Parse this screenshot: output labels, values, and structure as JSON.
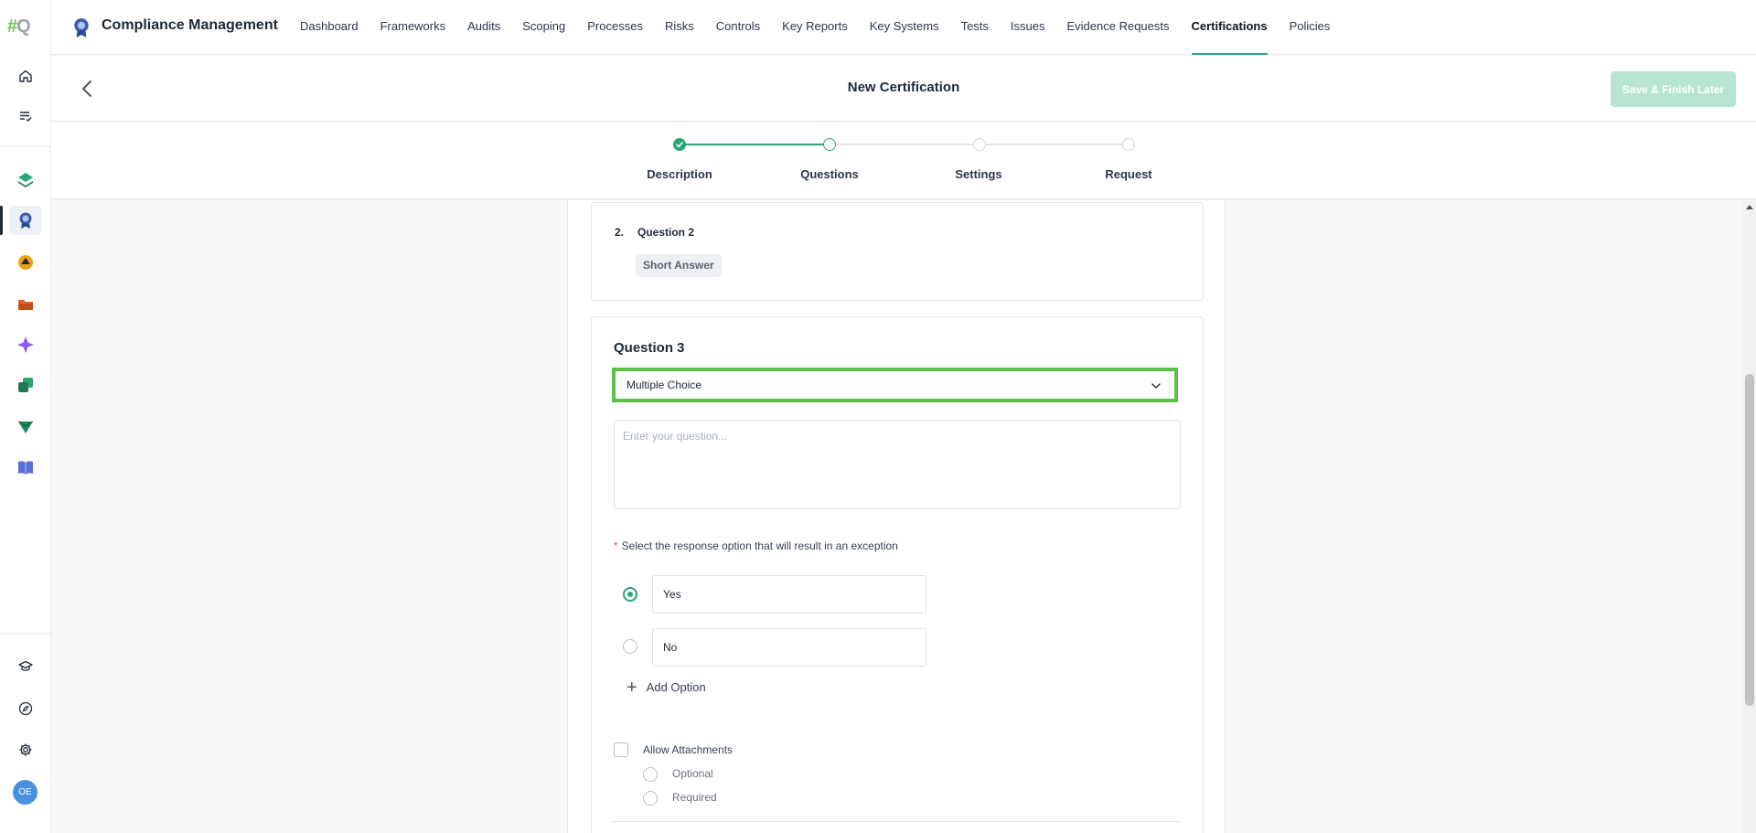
{
  "rail": {
    "logo_hash": "#",
    "logo_q": "Q",
    "avatar_initials": "OE"
  },
  "app": {
    "title": "Compliance Management"
  },
  "nav": {
    "items": [
      {
        "label": "Dashboard"
      },
      {
        "label": "Frameworks"
      },
      {
        "label": "Audits"
      },
      {
        "label": "Scoping"
      },
      {
        "label": "Processes"
      },
      {
        "label": "Risks"
      },
      {
        "label": "Controls"
      },
      {
        "label": "Key Reports"
      },
      {
        "label": "Key Systems"
      },
      {
        "label": "Tests"
      },
      {
        "label": "Issues"
      },
      {
        "label": "Evidence Requests"
      },
      {
        "label": "Certifications",
        "active": true
      },
      {
        "label": "Policies"
      }
    ]
  },
  "header": {
    "title": "New Certification",
    "save_label": "Save & Finish Later"
  },
  "stepper": {
    "steps": [
      {
        "label": "Description",
        "state": "done"
      },
      {
        "label": "Questions",
        "state": "current"
      },
      {
        "label": "Settings",
        "state": "pending"
      },
      {
        "label": "Request",
        "state": "pending"
      }
    ]
  },
  "question2": {
    "number": "2.",
    "text": "Question 2",
    "type": "Short Answer"
  },
  "question3": {
    "title": "Question 3",
    "type": "Multiple Choice",
    "question_placeholder": "Enter your question...",
    "exception_label": "Select the response option that will result in an exception",
    "required_marker": "*",
    "options": [
      {
        "value": "Yes",
        "selected": true
      },
      {
        "value": "No",
        "selected": false
      }
    ],
    "add_option_label": "Add Option",
    "allow_attachments_label": "Allow Attachments",
    "attachment_optional_label": "Optional",
    "attachment_required_label": "Required"
  },
  "colors": {
    "accent": "#2aa675",
    "highlight_border": "#5fbf49",
    "save_button_disabled": "#b6e6d2"
  }
}
